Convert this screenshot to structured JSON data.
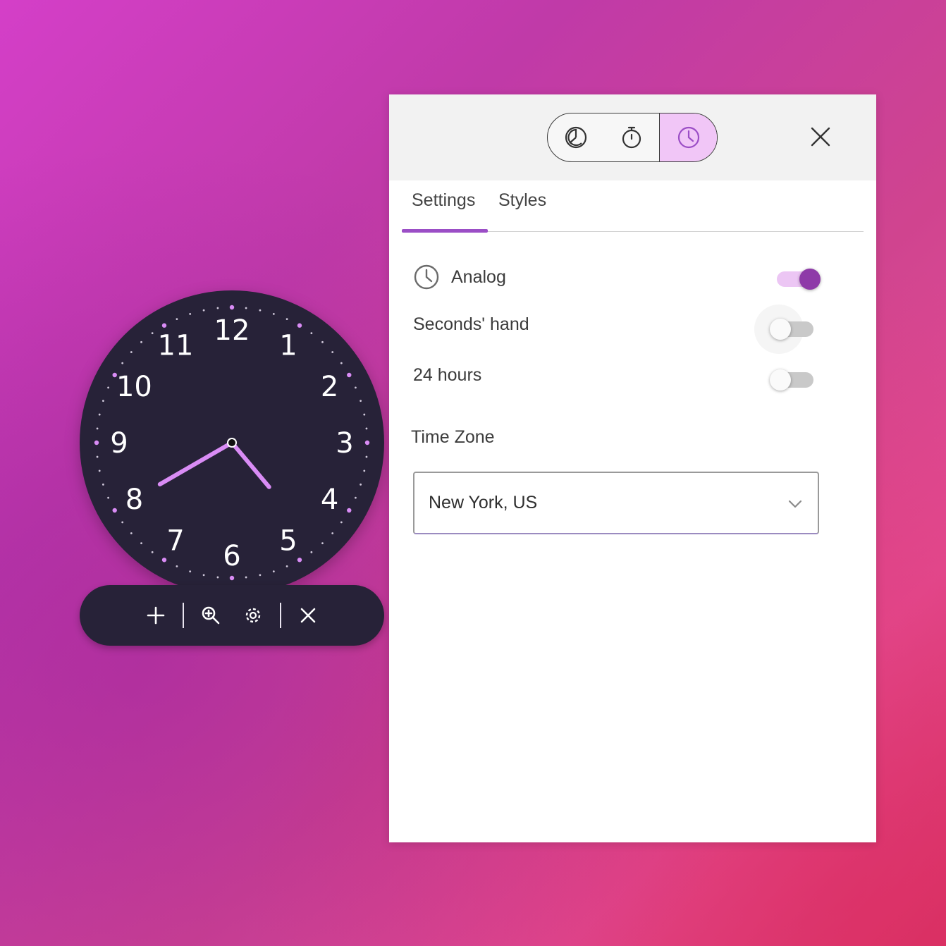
{
  "clock": {
    "numbers": [
      "12",
      "1",
      "2",
      "3",
      "4",
      "5",
      "6",
      "7",
      "8",
      "9",
      "10",
      "11"
    ],
    "time": {
      "hour": 4,
      "minute": 40
    },
    "colors": {
      "face": "#272238",
      "accent": "#d98cf5",
      "numerals": "#ffffff"
    }
  },
  "clock_toolbar": {
    "icons": [
      "plus-icon",
      "zoom-in-icon",
      "gear-icon",
      "close-icon"
    ]
  },
  "panel": {
    "mode_switch": {
      "buttons": [
        "pie-chart-icon",
        "stopwatch-icon",
        "clock-icon"
      ],
      "active": "clock-icon"
    },
    "tabs": {
      "settings": "Settings",
      "styles": "Styles",
      "active": "Settings"
    },
    "analog": {
      "label": "Analog",
      "enabled": true
    },
    "seconds_hand": {
      "label": "Seconds' hand",
      "enabled": false
    },
    "hours24": {
      "label": "24 hours",
      "enabled": false
    },
    "timezone": {
      "label": "Time Zone",
      "value": "New York, US"
    },
    "colors": {
      "accent": "#8e3aa8",
      "accent_light": "#ecc6f4",
      "active_mode_bg": "#f1c6f7"
    }
  }
}
